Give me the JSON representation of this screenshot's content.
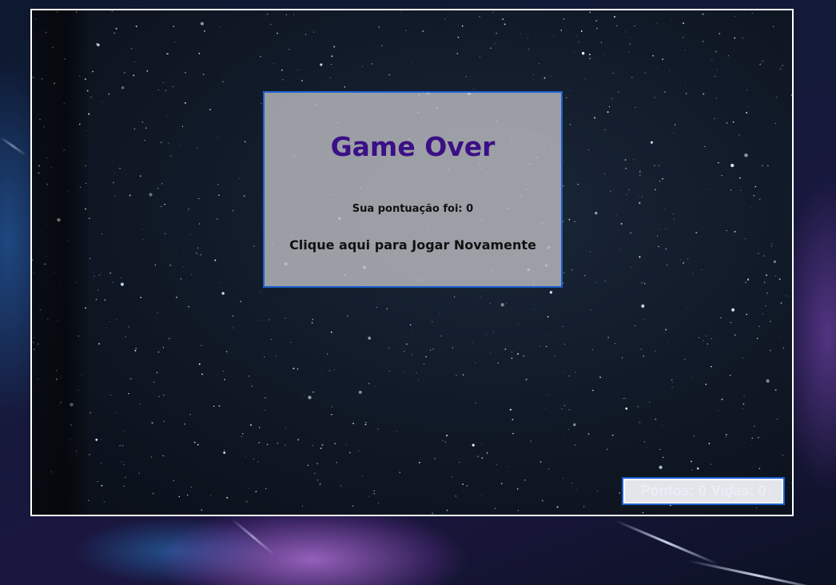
{
  "game_over": {
    "title": "Game Over",
    "score_text": "Sua pontuação foi: 0",
    "play_again": "Clique aqui para Jogar Novamente"
  },
  "hud": {
    "points_text": "Pontos: 0",
    "lives_text": "Vidas: 0"
  },
  "colors": {
    "title": "#3b0f86",
    "panel_border": "#1e5fd0",
    "board_border": "#ffffff"
  }
}
